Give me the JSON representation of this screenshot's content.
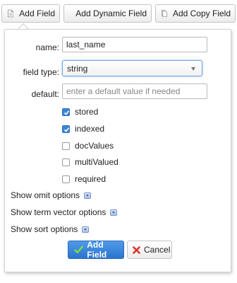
{
  "toolbar": {
    "add_field": "Add Field",
    "add_dynamic_field": "Add Dynamic Field",
    "add_copy_field": "Add Copy Field"
  },
  "form": {
    "name_label": "name:",
    "name_value": "last_name",
    "field_type_label": "field type:",
    "field_type_value": "string",
    "default_label": "default:",
    "default_placeholder": "enter a default value if needed",
    "checkboxes": [
      {
        "label": "stored",
        "checked": true
      },
      {
        "label": "indexed",
        "checked": true
      },
      {
        "label": "docValues",
        "checked": false
      },
      {
        "label": "multiValued",
        "checked": false
      },
      {
        "label": "required",
        "checked": false
      }
    ],
    "toggles": [
      "Show omit options",
      "Show term vector options",
      "Show sort options"
    ],
    "submit_label": "Add Field",
    "cancel_label": "Cancel"
  },
  "colors": {
    "accent": "#2b74cf",
    "checkbox_checked": "#3b86d8",
    "cancel_x": "#d9342b",
    "check_green": "#7ddc3c"
  }
}
